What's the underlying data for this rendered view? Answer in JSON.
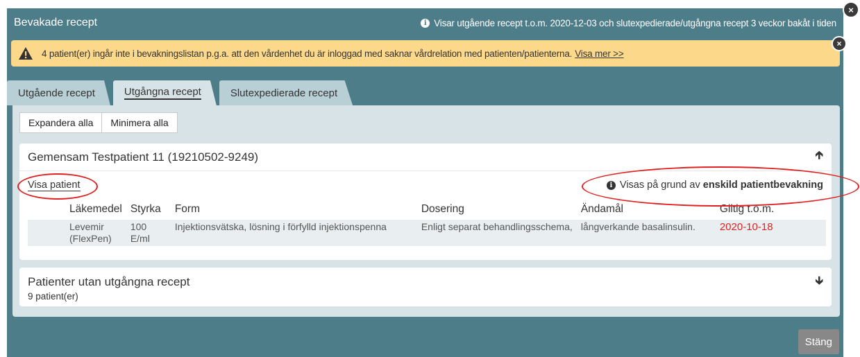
{
  "header": {
    "title": "Bevakade recept",
    "info": "Visar utgående recept t.o.m. 2020-12-03 och slutexpedierade/utgångna recept 3 veckor bakåt i tiden"
  },
  "warning": {
    "text": "4 patient(er) ingår inte i bevakningslistan p.g.a. att den vårdenhet du är inloggad med saknar vårdrelation med patienten/patienterna.",
    "link": "Visa mer >>"
  },
  "tabs": [
    {
      "label": "Utgående recept",
      "active": false
    },
    {
      "label": "Utgångna recept",
      "active": true
    },
    {
      "label": "Slutexpedierade recept",
      "active": false
    }
  ],
  "buttons": {
    "expand": "Expandera alla",
    "minimize": "Minimera alla"
  },
  "patient_card": {
    "name": "Gemensam Testpatient 11 (19210502-9249)",
    "show_patient": "Visa patient",
    "reason_prefix": "Visas på grund av ",
    "reason_bold": "enskild patientbevakning",
    "columns": [
      "Läkemedel",
      "Styrka",
      "Form",
      "Dosering",
      "Ändamål",
      "Giltig t.o.m."
    ],
    "rows": [
      {
        "drug": "Levemir (FlexPen)",
        "strength": "100 E/ml",
        "form": "Injektionsvätska, lösning i förfylld injektionspenna",
        "dosage": "Enligt separat behandlingsschema,",
        "purpose": "långverkande basalinsulin.",
        "valid": "2020-10-18"
      }
    ]
  },
  "other_card": {
    "title": "Patienter utan utgångna recept",
    "count": "9 patient(er)"
  },
  "close_label": "Stäng",
  "colors": {
    "header": "#4e7d8a",
    "warning": "#fcd98a",
    "date": "#dd2222",
    "annotation": "#e02020"
  }
}
